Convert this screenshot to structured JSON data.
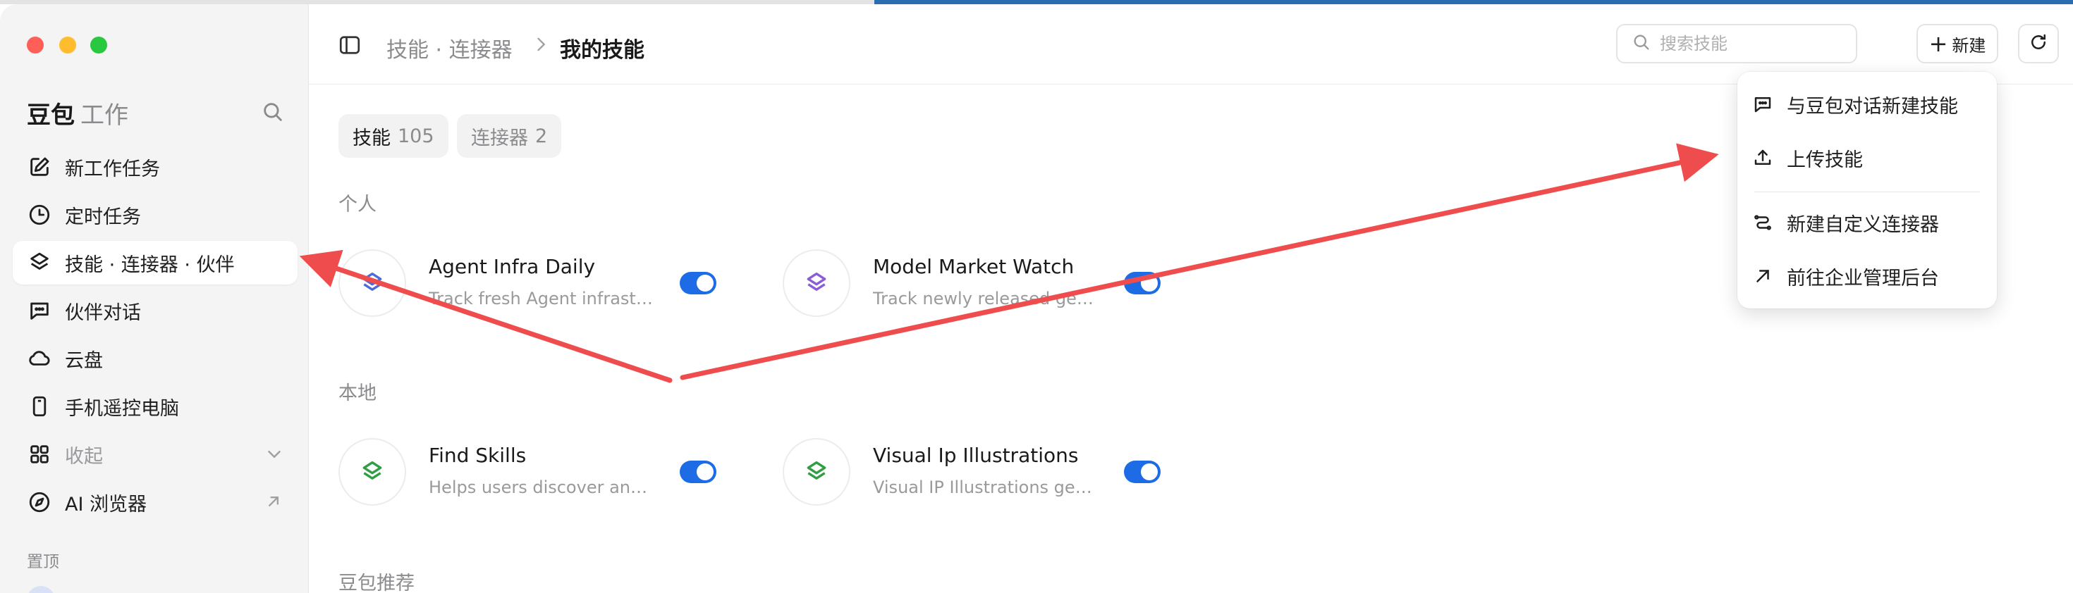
{
  "sidebar": {
    "brand": "豆包",
    "brand_sub": "工作",
    "items": [
      {
        "label": "新工作任务",
        "icon": "edit-icon"
      },
      {
        "label": "定时任务",
        "icon": "clock-icon"
      },
      {
        "label": "技能 · 连接器 · 伙伴",
        "icon": "layers-icon",
        "active": true
      },
      {
        "label": "伙伴对话",
        "icon": "chat-bubble-icon"
      },
      {
        "label": "云盘",
        "icon": "cloud-icon"
      },
      {
        "label": "手机遥控电脑",
        "icon": "phone-icon"
      },
      {
        "label": "收起",
        "icon": "grid-icon"
      },
      {
        "label": "AI 浏览器",
        "icon": "compass-icon"
      }
    ],
    "pinned_label": "置顶"
  },
  "header": {
    "breadcrumb_parent": "技能 · 连接器",
    "breadcrumb_current": "我的技能",
    "search_placeholder": "搜索技能",
    "new_label": "新建"
  },
  "tabs": [
    {
      "label": "技能",
      "count": "105"
    },
    {
      "label": "连接器",
      "count": "2"
    }
  ],
  "groups": {
    "personal": "个人",
    "local": "本地",
    "recommended": "豆包推荐"
  },
  "skills": {
    "personal": [
      {
        "title": "Agent Infra Daily",
        "desc": "Track fresh Agent infrastru...",
        "enabled": true,
        "accent": "#4b6bd8"
      },
      {
        "title": "Model Market Watch",
        "desc": "Track newly released gene...",
        "enabled": true,
        "accent": "#8a5cd8"
      }
    ],
    "local": [
      {
        "title": "Find Skills",
        "desc": "Helps users discover and i...",
        "enabled": true,
        "accent": "#2f9e44"
      },
      {
        "title": "Visual Ip Illustrations",
        "desc": "Visual IP Illustrations gene...",
        "enabled": true,
        "accent": "#2f9e44"
      }
    ]
  },
  "new_menu": {
    "items": [
      {
        "label": "与豆包对话新建技能",
        "icon": "chat-icon"
      },
      {
        "label": "上传技能",
        "icon": "upload-icon"
      },
      {
        "label": "新建自定义连接器",
        "icon": "connector-icon"
      },
      {
        "label": "前往企业管理后台",
        "icon": "arrow-up-right-icon"
      }
    ]
  },
  "colors": {
    "accent": "#1e6be6",
    "annotation": "#ef4d4d"
  }
}
